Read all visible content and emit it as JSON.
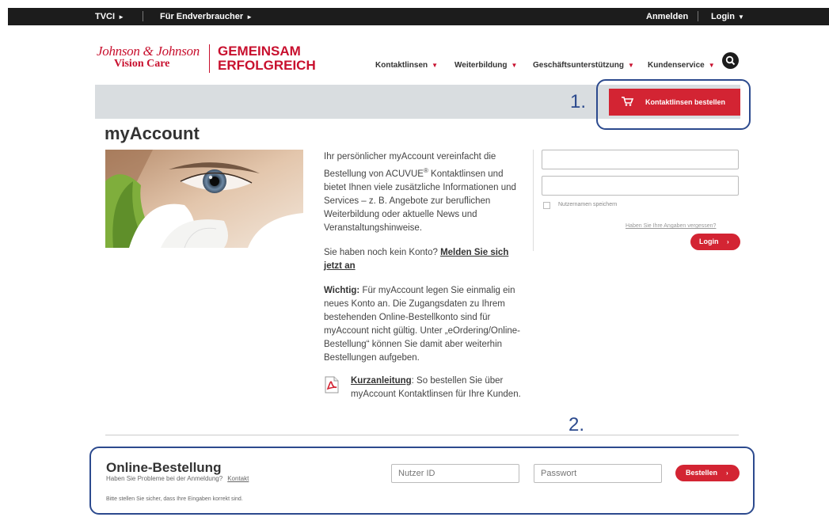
{
  "topbar": {
    "tvci": "TVCI",
    "consumers": "Für Endverbraucher",
    "register": "Anmelden",
    "login": "Login"
  },
  "header": {
    "logo_brand": "Johnson & Johnson",
    "logo_sub": "Vision Care",
    "tagline_line1": "GEMEINSAM",
    "tagline_line2": "ERFOLGREICH",
    "nav": [
      "Kontaktlinsen",
      "Weiterbildung",
      "Geschäftsunterstützung",
      "Kundenservice"
    ]
  },
  "order_button": {
    "label": "Kontaktlinsen bestellen",
    "annotation": "1."
  },
  "main": {
    "title": "myAccount",
    "intro_p1_a": "Ihr persönlicher myAccount vereinfacht die Bestellung von ACUVUE",
    "intro_p1_sup": "®",
    "intro_p1_b": " Kontaktlinsen und bietet Ihnen viele zusätzliche Informationen und Services – z. B. Angebote zur beruflichen Weiterbildung oder aktuelle News und Veranstaltungshinweise.",
    "intro_p2": "Sie haben noch kein Konto? ",
    "intro_p2_link": "Melden Sie sich jetzt an",
    "intro_p3_strong": "Wichtig:",
    "intro_p3": " Für myAccount legen Sie einmalig ein neues Konto an. Die Zugangsdaten zu Ihrem bestehenden Online-Bestellkonto sind für myAccount nicht gültig. Unter „eOrdering/Online-Bestellung“ können Sie damit aber weiterhin Bestellungen aufgeben.",
    "pdf_link": "Kurzanleitung",
    "pdf_text": ": So bestellen Sie über myAccount Kontaktlinsen für Ihre Kunden."
  },
  "login_form": {
    "username_value": "",
    "password_value": "",
    "remember_label": "Nutzernamen speichern",
    "forgot_link": "Haben Sie Ihre Angaben vergessen?",
    "login_button": "Login"
  },
  "online_order": {
    "annotation": "2.",
    "title": "Online-Bestellung",
    "help_text": "Haben Sie Probleme bei der Anmeldung?",
    "contact_link": "Kontakt",
    "user_placeholder": "Nutzer ID",
    "password_placeholder": "Passwort",
    "submit_button": "Bestellen",
    "note": "Bitte stellen Sie sicher, dass Ihre Eingaben korrekt sind."
  },
  "colors": {
    "brand_red": "#d32433",
    "annotation_blue": "#2c4a8e",
    "topbar_bg": "#1c1c1c",
    "band_gray": "#d9dde0"
  }
}
